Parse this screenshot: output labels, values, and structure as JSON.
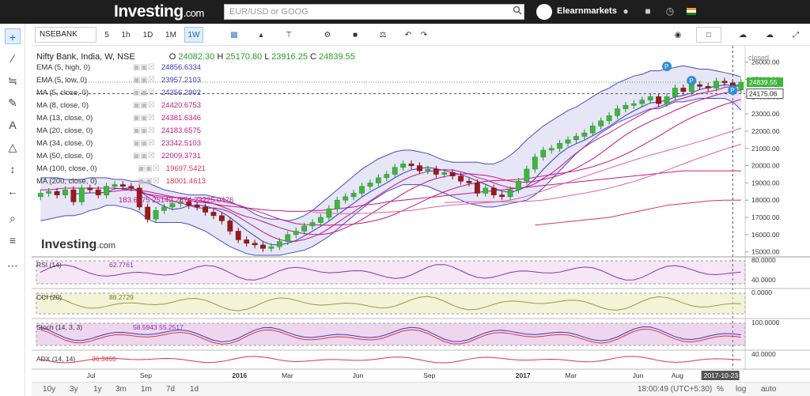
{
  "topbar": {
    "logo_text": "Investing",
    "logo_suffix": ".com",
    "search_placeholder": "EUR/USD or GOOG",
    "user_name": "Elearnmarkets",
    "colors": {
      "bg": "#1e1e1e"
    }
  },
  "toolbar": {
    "symbol": "NSEBANK",
    "intervals": [
      "5",
      "1h",
      "1D",
      "1M",
      "1W"
    ],
    "active_interval": "1W"
  },
  "bottombar": {
    "ranges": [
      "10y",
      "3y",
      "1y",
      "3m",
      "1m",
      "7d",
      "1d"
    ],
    "time_readout": "18:00:49 (UTC+5:30)",
    "scale_options": [
      "%",
      "log",
      "auto"
    ]
  },
  "legend": {
    "title": "Nifty Bank, India, W, NSE",
    "ohlc": {
      "O": "24082.30",
      "H": "25170.80",
      "L": "23916.25",
      "C": "24839.55"
    },
    "overlays": [
      {
        "label": "EMA (5, high, 0)",
        "value": "24856.6334",
        "color": "#3b3bb8"
      },
      {
        "label": "EMA (5, low, 0)",
        "value": "23957.2103",
        "color": "#3b3bb8"
      },
      {
        "label": "MA (5, close, 0)",
        "value": "24356.2902",
        "color": "#3b3bb8"
      },
      {
        "label": "MA (8, close, 0)",
        "value": "24420.6753",
        "color": "#c71585"
      },
      {
        "label": "MA (13, close, 0)",
        "value": "24381.6346",
        "color": "#c71585"
      },
      {
        "label": "MA (20, close, 0)",
        "value": "24183.6575",
        "color": "#c71585"
      },
      {
        "label": "MA (34, close, 0)",
        "value": "23342.5103",
        "color": "#c71585"
      },
      {
        "label": "MA (50, close, 0)",
        "value": "22009.3731",
        "color": "#c71585"
      },
      {
        "label": "MA (100, close, 0)",
        "value": "19697.5421",
        "color": "#d9364a"
      },
      {
        "label": "MA (200, close, 0)",
        "value": "18001.4613",
        "color": "#d9364a"
      }
    ],
    "bb_values": "183.6575  25142.2674  23225.0476",
    "closed_label": "closed"
  },
  "chart_data": {
    "type": "line",
    "title": "Nifty Bank, India, W, NSE",
    "y_ticks": [
      15000,
      16000,
      17000,
      18000,
      19000,
      20000,
      21000,
      22000,
      23000,
      24000,
      25000,
      26000
    ],
    "y_tick_labels": [
      "15000.00",
      "16000.00",
      "17000.00",
      "18000.00",
      "19000.00",
      "20000.00",
      "21000.00",
      "22000.00",
      "23000.00",
      "24000.00",
      "25000.00",
      "26000.00"
    ],
    "ylim": [
      14800,
      26400
    ],
    "x_labels": [
      "Jul",
      "Sep",
      "2016",
      "Mar",
      "Jun",
      "Sep",
      "2017",
      "Mar",
      "Jun",
      "Aug",
      "2017-10-23"
    ],
    "x_positions": [
      0.08,
      0.155,
      0.285,
      0.355,
      0.455,
      0.555,
      0.685,
      0.755,
      0.85,
      0.905,
      0.965
    ],
    "price_close": [
      18400,
      18500,
      18300,
      18600,
      17900,
      18700,
      18600,
      18300,
      18800,
      18900,
      18800,
      18700,
      17600,
      16900,
      17400,
      17600,
      17800,
      17900,
      17700,
      17600,
      17300,
      17100,
      16800,
      16200,
      15700,
      15500,
      15400,
      15200,
      15300,
      15600,
      16000,
      16200,
      16500,
      16700,
      17000,
      17500,
      18000,
      18200,
      18400,
      18800,
      19000,
      19300,
      19500,
      19900,
      20100,
      20000,
      19700,
      19800,
      19500,
      19600,
      19400,
      19100,
      19000,
      18400,
      18700,
      18300,
      18200,
      18600,
      19100,
      19800,
      20500,
      20900,
      21000,
      21300,
      21500,
      21700,
      21900,
      22300,
      22600,
      22900,
      23300,
      23500,
      23600,
      23800,
      24000,
      23600,
      24000,
      24500,
      24300,
      24700,
      24600,
      24500,
      24900,
      24800,
      24400,
      24839
    ],
    "bb_upper": [
      19300,
      19300,
      19300,
      19200,
      19200,
      19200,
      19300,
      19300,
      19300,
      19200,
      19200,
      19100,
      19100,
      19000,
      18800,
      18600,
      18500,
      18400,
      18300,
      18300,
      18300,
      18200,
      18100,
      17900,
      17700,
      17500,
      17200,
      17000,
      16900,
      16900,
      16800,
      16900,
      17100,
      17400,
      17800,
      18200,
      18600,
      19000,
      19400,
      19800,
      20100,
      20400,
      20600,
      20800,
      20900,
      20900,
      20800,
      20700,
      20500,
      20300,
      20200,
      20200,
      20200,
      20200,
      20100,
      20100,
      20300,
      20600,
      21000,
      21500,
      21900,
      22300,
      22600,
      22900,
      23200,
      23400,
      23700,
      24000,
      24300,
      24500,
      24800,
      25000,
      25200,
      25300,
      25500,
      25500,
      25600,
      25700,
      25800,
      25700,
      25600,
      25600,
      25500,
      25400,
      25300,
      25142
    ],
    "bb_lower": [
      16800,
      16900,
      17000,
      17100,
      17100,
      17200,
      17400,
      17500,
      17700,
      17700,
      17600,
      17500,
      17300,
      16900,
      16700,
      16700,
      16700,
      16700,
      16600,
      16400,
      16200,
      15900,
      15600,
      15300,
      15100,
      14900,
      14800,
      14800,
      14800,
      14800,
      14900,
      15000,
      15100,
      15300,
      15600,
      15900,
      16300,
      16700,
      17100,
      17500,
      17900,
      18200,
      18500,
      18700,
      18900,
      18900,
      18900,
      18800,
      18600,
      18400,
      18200,
      18000,
      17800,
      17700,
      17600,
      17600,
      17700,
      17800,
      17900,
      18000,
      18300,
      18700,
      19200,
      19700,
      20200,
      20700,
      21100,
      21500,
      21900,
      22200,
      22500,
      22700,
      22900,
      23100,
      23300,
      23300,
      23500,
      23700,
      23700,
      23800,
      23900,
      23900,
      23900,
      23900,
      23700,
      23225
    ],
    "ma100": [
      18600,
      18600,
      18650,
      18700,
      18700,
      18700,
      18700,
      18700,
      18700,
      18700,
      18650,
      18600,
      18550,
      18500,
      18400,
      18300,
      18200,
      18100,
      18000,
      17900,
      17850,
      17800,
      17700,
      17650,
      17600,
      17550,
      17500,
      17450,
      17400,
      17400,
      17350,
      17350,
      17350,
      17400,
      17400,
      17450,
      17500,
      17550,
      17600,
      17700,
      17750,
      17800,
      17900,
      17950,
      18000,
      18050,
      18100,
      18150,
      18200,
      18250,
      18300,
      18350,
      18400,
      18450,
      18500,
      18550,
      18600,
      18650,
      18700,
      18750,
      18800,
      18850,
      18900,
      18950,
      19000,
      19050,
      19100,
      19150,
      19200,
      19250,
      19300,
      19350,
      19400,
      19450,
      19500,
      19550,
      19600,
      19650,
      19700,
      19700,
      19700,
      19700,
      19700,
      19700,
      19700,
      19697
    ],
    "ma200": [
      null,
      null,
      null,
      null,
      null,
      null,
      null,
      null,
      null,
      null,
      null,
      null,
      null,
      null,
      null,
      null,
      null,
      null,
      null,
      null,
      null,
      null,
      null,
      null,
      null,
      null,
      null,
      null,
      null,
      null,
      null,
      null,
      null,
      null,
      null,
      null,
      null,
      null,
      null,
      null,
      null,
      null,
      null,
      null,
      null,
      null,
      null,
      null,
      null,
      null,
      null,
      null,
      null,
      null,
      null,
      null,
      null,
      null,
      null,
      null,
      16550,
      16600,
      16650,
      16700,
      16750,
      16800,
      16850,
      16900,
      16950,
      17000,
      17100,
      17200,
      17300,
      17400,
      17500,
      17600,
      17700,
      17750,
      17800,
      17850,
      17900,
      17950,
      17980,
      18000,
      18000,
      18001
    ],
    "indicators": [
      {
        "name": "RSI (14)",
        "value": "62.7761",
        "ticks": [
          "80.0000",
          "40.0000"
        ]
      },
      {
        "name": "CCI (20)",
        "value": "88.2729",
        "ticks": [
          "0.0000"
        ]
      },
      {
        "name": "Stoch (14, 3, 3)",
        "value": "58.5943  55.2517",
        "ticks": [
          "100.0000"
        ]
      },
      {
        "name": "ADX (14, 14)",
        "value": "36.3465",
        "ticks": [
          "40.0000"
        ]
      }
    ],
    "price_labels": {
      "last": "24839.55",
      "crosshair": "24175.06"
    }
  }
}
